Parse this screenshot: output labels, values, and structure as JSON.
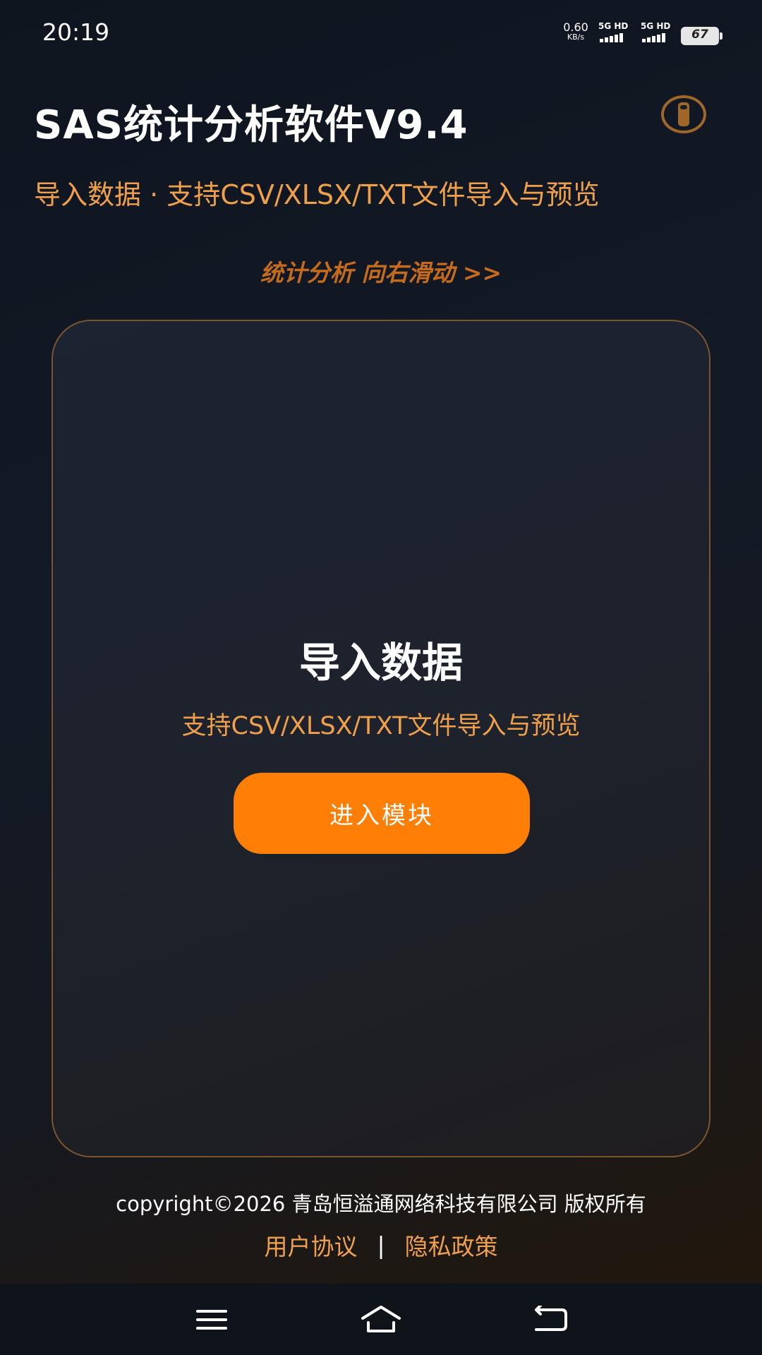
{
  "status_bar": {
    "time": "20:19",
    "net_speed_value": "0.60",
    "net_speed_unit": "KB/s",
    "sim1_label": "5G HD",
    "sim2_label": "5G HD",
    "battery_level": "67"
  },
  "header": {
    "title": "SAS统计分析软件V9.4",
    "info_icon": "info-icon"
  },
  "subtitle": "导入数据 · 支持CSV/XLSX/TXT文件导入与预览",
  "swipe_hint": "统计分析 向右滑动 >>",
  "module_card": {
    "title": "导入数据",
    "description": "支持CSV/XLSX/TXT文件导入与预览",
    "button_label": "进入模块"
  },
  "footer": {
    "copyright": "copyright©2026 青岛恒溢通网络科技有限公司 版权所有",
    "user_agreement": "用户协议",
    "separator": "|",
    "privacy_policy": "隐私政策"
  },
  "nav_bar": {
    "menu_icon": "menu-icon",
    "home_icon": "home-icon",
    "back_icon": "back-icon"
  },
  "colors": {
    "accent": "#ff7e06",
    "accent_text": "#f0a04b",
    "hint_text": "#c56b1b",
    "card_border": "#7a552e"
  }
}
